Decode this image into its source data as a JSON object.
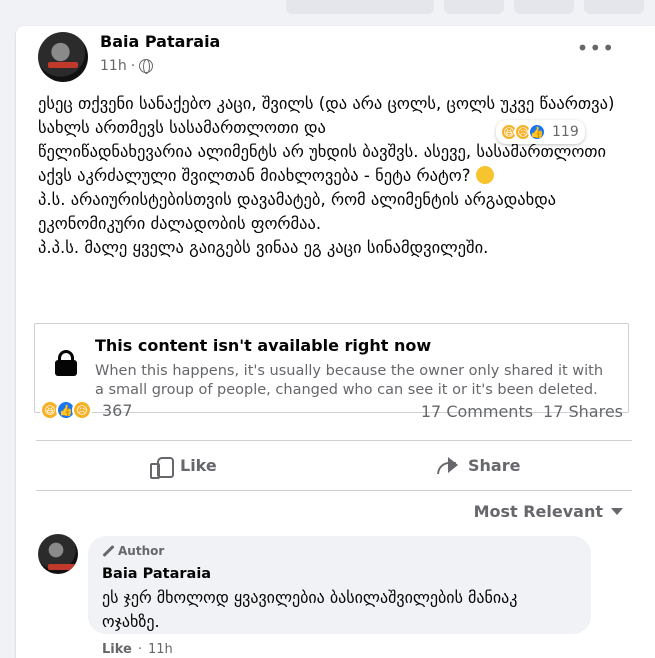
{
  "post": {
    "author": "Baia Pataraia",
    "time": "11h",
    "separator": "·",
    "more_icon": "•••",
    "text_lines": [
      "ესეც თქვენი სანაქებო კაცი, შვილს (და არა ცოლს, ცოლს უკვე წაართვა) სახლს ართმევს სასამართლოთი და",
      "წელიწადნახევარია ალიმენტს არ უხდის ბავშვს. ასევე, სასამართლოთი აქვს აკრძალული შვილთან მიახლოვება - ნეტა რატო?",
      "პ.ს. არაიურისტებისთვის დავამატებ, რომ ალიმენტის არგადახდა ეკონომიკური ძალადობის ფორმაა.",
      "პ.პ.ს. მალე ყველა გაიგებს ვინაა ეგ კაცი სინამდვილეში."
    ]
  },
  "unavailable": {
    "title": "This content isn't available right now",
    "description": "When this happens, it's usually because the owner only shared it with a small group of people, changed who can see it or it's been deleted."
  },
  "stats": {
    "reaction_count": "367",
    "comments": "17 Comments",
    "shares": "17 Shares"
  },
  "actions": {
    "like": "Like",
    "share": "Share"
  },
  "sort": {
    "label": "Most Relevant"
  },
  "comment": {
    "badge": "Author",
    "author": "Baia Pataraia",
    "text": "ეს ჯერ მხოლოდ ყვავილებია ბასილაშვილების მანიაკ ოჯახზე.",
    "reaction_count": "119",
    "like_link": "Like",
    "separator": "·",
    "time": "11h"
  },
  "colors": {
    "like_blue": "#1877f2",
    "emoji_yellow": "#f7b125",
    "secondary_text": "#65676b"
  }
}
